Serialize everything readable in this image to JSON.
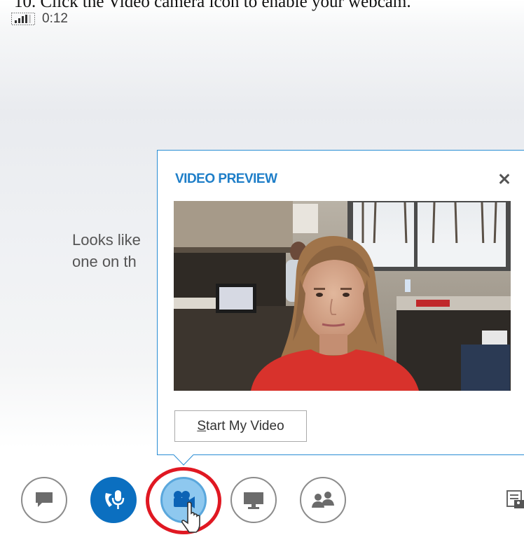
{
  "instruction": "10. Click the Video camera icon to enable your webcam.",
  "status": {
    "signal_icon": "signal-strength-icon",
    "elapsed": "0:12"
  },
  "conversation": {
    "message_line_1": "Looks like",
    "message_line_2": "one on th"
  },
  "video_preview": {
    "title": "VIDEO PREVIEW",
    "close_icon": "close-icon",
    "start_button_mnemonic": "S",
    "start_button_rest": "tart My Video"
  },
  "toolbar": {
    "buttons": [
      {
        "name": "instant-message-button",
        "icon": "speech-bubble-icon"
      },
      {
        "name": "call-button",
        "icon": "phone-microphone-icon"
      },
      {
        "name": "video-button",
        "icon": "video-camera-icon",
        "state": "active"
      },
      {
        "name": "present-button",
        "icon": "monitor-icon"
      },
      {
        "name": "participants-button",
        "icon": "people-icon"
      }
    ]
  },
  "colors": {
    "accent_blue": "#1e7ec8",
    "call_button_blue": "#0b6fc0",
    "video_button_blue": "#8ec8ef",
    "highlight_red": "#e01822"
  }
}
